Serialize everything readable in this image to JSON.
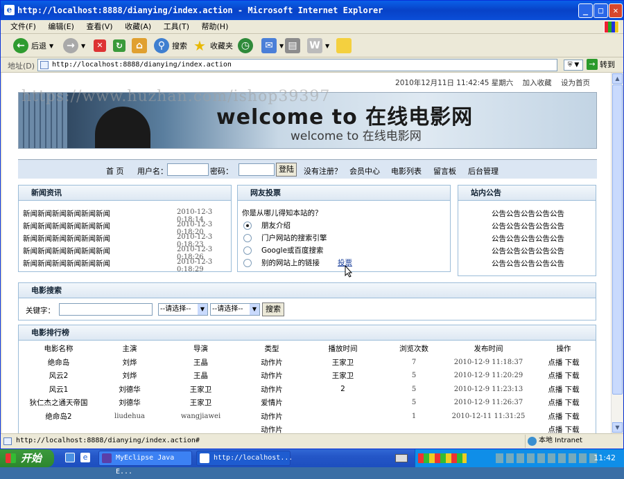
{
  "window": {
    "title": "http://localhost:8888/dianying/index.action - Microsoft Internet Explorer"
  },
  "menu": [
    "文件(F)",
    "编辑(E)",
    "查看(V)",
    "收藏(A)",
    "工具(T)",
    "帮助(H)"
  ],
  "toolbar": {
    "back": "后退",
    "search": "搜索",
    "favorites": "收藏夹"
  },
  "address": {
    "label": "地址(D)",
    "url": "http://localhost:8888/dianying/index.action",
    "go": "转到"
  },
  "page": {
    "datetime": "2010年12月11日  11:42:45  星期六",
    "add_favorite": "加入收藏",
    "set_home": "设为首页",
    "watermark": "https://www.huzhan.com/ishop39397",
    "banner_title": "welcome to 在线电影网",
    "banner_sub": "welcome to 在线电影网",
    "nav": {
      "home": "首 页",
      "username_label": "用户名：",
      "password_label": "密码：",
      "login": "登陆",
      "register": "没有注册？",
      "member": "会员中心",
      "movies": "电影列表",
      "guestbook": "留言板",
      "admin": "后台管理"
    },
    "news": {
      "title": "新闻资讯",
      "items": [
        {
          "text": "新闻新闻新闻新闻新闻新闻",
          "date": "2010-12-3 0:18:14"
        },
        {
          "text": "新闻新闻新闻新闻新闻新闻",
          "date": "2010-12-3 0:18:20"
        },
        {
          "text": "新闻新闻新闻新闻新闻新闻",
          "date": "2010-12-3 0:18:23"
        },
        {
          "text": "新闻新闻新闻新闻新闻新闻",
          "date": "2010-12-3 0:18:26"
        },
        {
          "text": "新闻新闻新闻新闻新闻新闻",
          "date": "2010-12-3 0:18:29"
        }
      ]
    },
    "vote": {
      "title": "网友投票",
      "question": "你是从哪儿得知本站的？",
      "options": [
        "朋友介绍",
        "门户网站的搜索引擎",
        "Google或百度搜索",
        "别的网站上的链接"
      ],
      "selected": 0,
      "submit": "投票"
    },
    "notice": {
      "title": "站内公告",
      "items": [
        "公告公告公告公告公告",
        "公告公告公告公告公告",
        "公告公告公告公告公告",
        "公告公告公告公告公告",
        "公告公告公告公告公告"
      ]
    },
    "search": {
      "title": "电影搜索",
      "keyword_label": "关键字：",
      "select1": "--请选择--",
      "select2": "--请选择--",
      "button": "搜索"
    },
    "ranking": {
      "title": "电影排行榜",
      "headers": [
        "电影名称",
        "主演",
        "导演",
        "类型",
        "播放时间",
        "浏览次数",
        "发布时间",
        "操作"
      ],
      "rows": [
        [
          "绝命岛",
          "刘烨",
          "王晶",
          "动作片",
          "王家卫",
          "7",
          "2010-12-9 11:18:37",
          "点播  下载"
        ],
        [
          "风云2",
          "刘烨",
          "王晶",
          "动作片",
          "王家卫",
          "5",
          "2010-12-9 11:20:29",
          "点播  下载"
        ],
        [
          "风云1",
          "刘德华",
          "王家卫",
          "动作片",
          "2",
          "5",
          "2010-12-9 11:23:13",
          "点播  下载"
        ],
        [
          "狄仁杰之通天帝国",
          "刘德华",
          "王家卫",
          "爱情片",
          "",
          "5",
          "2010-12-9 11:26:37",
          "点播  下载"
        ],
        [
          "绝命岛2",
          "liudehua",
          "wangjiawei",
          "动作片",
          "",
          "1",
          "2010-12-11 11:31:25",
          "点播  下载"
        ],
        [
          "",
          "",
          "",
          "动作片",
          "",
          "",
          "",
          "点播  下载"
        ]
      ]
    }
  },
  "status": {
    "url": "http://localhost:8888/dianying/index.action#",
    "zone": "本地 Intranet"
  },
  "taskbar": {
    "start": "开始",
    "tasks": [
      "MyEclipse Java E...",
      "http://localhost..."
    ],
    "clock": "11:42"
  },
  "colors": {
    "titlebar": "#0842c7",
    "taskbar": "#2456c7",
    "start": "#2d862d",
    "box_border": "#9bbcd8"
  }
}
